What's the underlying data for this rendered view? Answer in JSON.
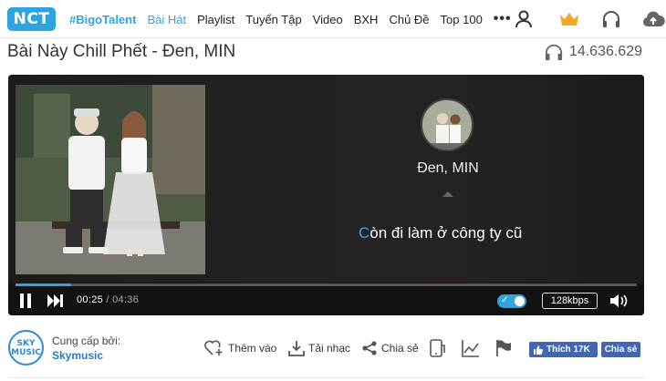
{
  "header": {
    "logo_text": "NCT",
    "nav": [
      {
        "label": "#BigoTalent",
        "kind": "hashtag"
      },
      {
        "label": "Bài Hát",
        "kind": "active"
      },
      {
        "label": "Playlist",
        "kind": "normal"
      },
      {
        "label": "Tuyển Tập",
        "kind": "normal"
      },
      {
        "label": "Video",
        "kind": "normal"
      },
      {
        "label": "BXH",
        "kind": "normal"
      },
      {
        "label": "Chủ Đề",
        "kind": "normal"
      },
      {
        "label": "Top 100",
        "kind": "normal"
      }
    ],
    "more": "•••",
    "icons": [
      "user-icon",
      "crown-icon",
      "headphones-icon",
      "cloud-upload-icon"
    ]
  },
  "song": {
    "title": "Bài Này Chill Phết - Đen, MIN",
    "listen_count": "14.636.629"
  },
  "player": {
    "artist": "Đen, MIN",
    "lyric_highlight": "C",
    "lyric_rest": "òn đi làm ở công ty cũ",
    "current_time": "00:25",
    "separator": "/",
    "total_time": "04:36",
    "progress": 0.09,
    "quality": "128kbps",
    "lyric_toggle_on": true
  },
  "provider": {
    "logo_line1": "SKY",
    "logo_line2": "MUSIC",
    "label": "Cung cấp bởi:",
    "name": "Skymusic"
  },
  "actions": {
    "add_label": "Thêm vào",
    "download_label": "Tải nhạc",
    "share_label": "Chia sẻ"
  },
  "social": {
    "like_label": "Thích 17K",
    "share_label": "Chia sẻ"
  },
  "colors": {
    "accent": "#2fa5e0",
    "facebook": "#4267b2",
    "crown": "#f5a623"
  }
}
